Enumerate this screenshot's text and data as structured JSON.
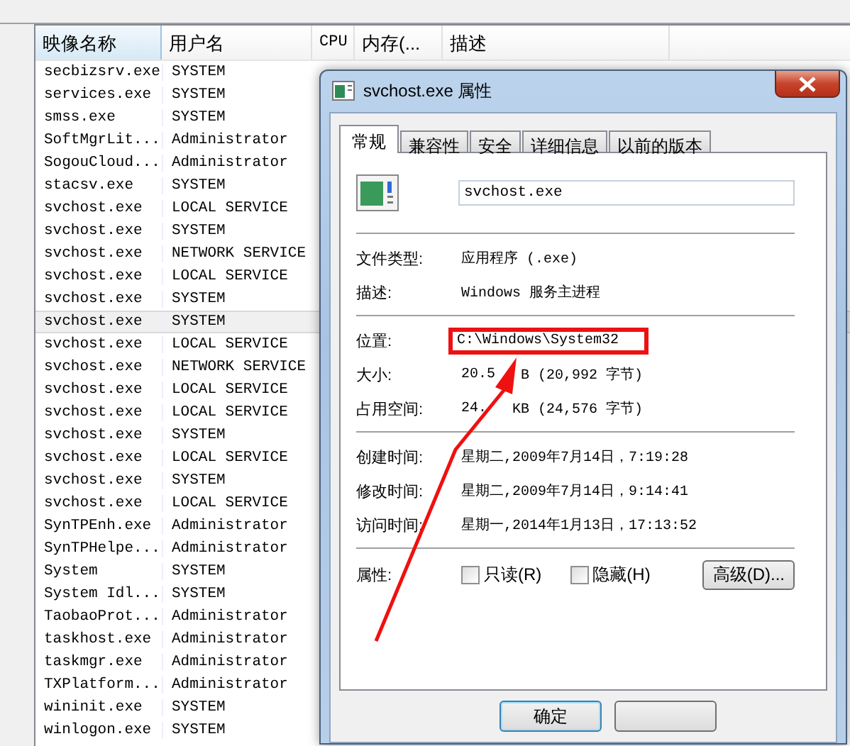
{
  "process_list": {
    "columns": [
      "映像名称",
      "用户名",
      "CPU",
      "内存(...",
      "描述"
    ],
    "rows": [
      {
        "image": "secbizsrv.exe",
        "user": "SYSTEM",
        "selected": false
      },
      {
        "image": "services.exe",
        "user": "SYSTEM",
        "selected": false
      },
      {
        "image": "smss.exe",
        "user": "SYSTEM",
        "selected": false
      },
      {
        "image": "SoftMgrLit...",
        "user": "Administrator",
        "selected": false
      },
      {
        "image": "SogouCloud...",
        "user": "Administrator",
        "selected": false
      },
      {
        "image": "stacsv.exe",
        "user": "SYSTEM",
        "selected": false
      },
      {
        "image": "svchost.exe",
        "user": "LOCAL SERVICE",
        "selected": false
      },
      {
        "image": "svchost.exe",
        "user": "SYSTEM",
        "selected": false
      },
      {
        "image": "svchost.exe",
        "user": "NETWORK SERVICE",
        "selected": false
      },
      {
        "image": "svchost.exe",
        "user": "LOCAL SERVICE",
        "selected": false
      },
      {
        "image": "svchost.exe",
        "user": "SYSTEM",
        "selected": false
      },
      {
        "image": "svchost.exe",
        "user": "SYSTEM",
        "selected": true
      },
      {
        "image": "svchost.exe",
        "user": "LOCAL SERVICE",
        "selected": false
      },
      {
        "image": "svchost.exe",
        "user": "NETWORK SERVICE",
        "selected": false
      },
      {
        "image": "svchost.exe",
        "user": "LOCAL SERVICE",
        "selected": false
      },
      {
        "image": "svchost.exe",
        "user": "LOCAL SERVICE",
        "selected": false
      },
      {
        "image": "svchost.exe",
        "user": "SYSTEM",
        "selected": false
      },
      {
        "image": "svchost.exe",
        "user": "LOCAL SERVICE",
        "selected": false
      },
      {
        "image": "svchost.exe",
        "user": "SYSTEM",
        "selected": false
      },
      {
        "image": "svchost.exe",
        "user": "LOCAL SERVICE",
        "selected": false
      },
      {
        "image": "SynTPEnh.exe",
        "user": "Administrator",
        "selected": false
      },
      {
        "image": "SynTPHelpe...",
        "user": "Administrator",
        "selected": false
      },
      {
        "image": "System",
        "user": "SYSTEM",
        "selected": false
      },
      {
        "image": "System Idl...",
        "user": "SYSTEM",
        "selected": false
      },
      {
        "image": "TaobaoProt...",
        "user": "Administrator",
        "selected": false
      },
      {
        "image": "taskhost.exe",
        "user": "Administrator",
        "selected": false
      },
      {
        "image": "taskmgr.exe",
        "user": "Administrator",
        "selected": false
      },
      {
        "image": "TXPlatform...",
        "user": "Administrator",
        "selected": false
      },
      {
        "image": "wininit.exe",
        "user": "SYSTEM",
        "selected": false
      },
      {
        "image": "winlogon.exe",
        "user": "SYSTEM",
        "selected": false
      }
    ]
  },
  "dialog": {
    "title": "svchost.exe 属性",
    "tabs": [
      {
        "label": "常规",
        "selected": true
      },
      {
        "label": "兼容性",
        "selected": false
      },
      {
        "label": "安全",
        "selected": false
      },
      {
        "label": "详细信息",
        "selected": false
      },
      {
        "label": "以前的版本",
        "selected": false
      }
    ],
    "file_name": "svchost.exe",
    "groups": [
      [
        {
          "label": "文件类型:",
          "value": "应用程序 (.exe)",
          "highlighted": false
        },
        {
          "label": "描述:",
          "value": "Windows 服务主进程",
          "highlighted": false
        }
      ],
      [
        {
          "label": "位置:",
          "value": "C:\\Windows\\System32",
          "highlighted": true
        },
        {
          "label": "大小:",
          "value": [
            "20.5",
            "B (20,992 字节)"
          ]
        },
        {
          "label": "占用空间:",
          "value": [
            "24.",
            "KB (24,576 字节)"
          ]
        }
      ],
      [
        {
          "label": "创建时间:",
          "value": "星期二,2009年7月14日，7:19:28",
          "highlighted": false
        },
        {
          "label": "修改时间:",
          "value": "星期二,2009年7月14日，9:14:41",
          "highlighted": false
        },
        {
          "label": "访问时间:",
          "value": "星期一,2014年1月13日，17:13:52",
          "highlighted": false
        }
      ]
    ],
    "attributes": {
      "label": "属性:",
      "checkboxes": [
        {
          "label": "只读(R)",
          "checked": false
        },
        {
          "label": "隐藏(H)",
          "checked": false
        }
      ],
      "advanced_button": "高级(D)..."
    },
    "buttons": [
      {
        "kind": "default",
        "label": "确定"
      },
      {
        "kind": "covered"
      }
    ]
  }
}
